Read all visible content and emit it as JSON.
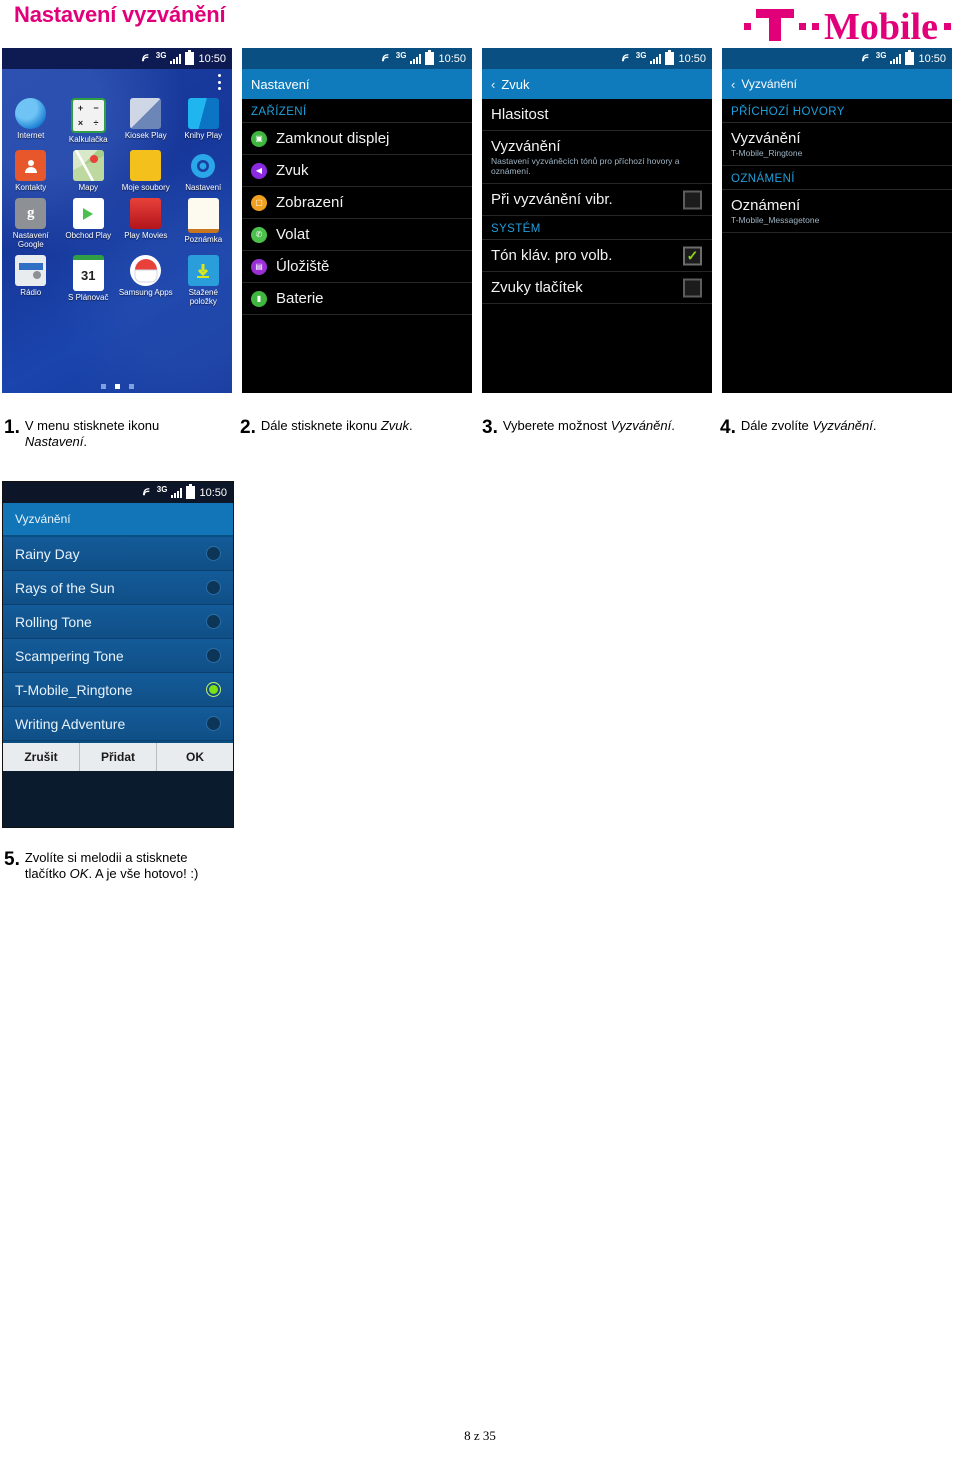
{
  "document": {
    "title": "Nastavení vyzvánění",
    "brand_logo": "T··Mobile·",
    "brand_color": "#e2007a",
    "footer": "8 z 35"
  },
  "status_bar": {
    "nfc_icon": "nfc-icon",
    "network": "3G",
    "signal_icon": "signal-bars-icon",
    "battery_icon": "battery-icon",
    "time": "10:50"
  },
  "screens": {
    "app_drawer": {
      "menu_icon": "overflow-menu-icon",
      "apps": [
        {
          "label": "Internet",
          "icon": "internet-icon"
        },
        {
          "label": "Kalkulačka",
          "icon": "calculator-icon"
        },
        {
          "label": "Kiosek Play",
          "icon": "play-newsstand-icon"
        },
        {
          "label": "Knihy Play",
          "icon": "play-books-icon"
        },
        {
          "label": "Kontakty",
          "icon": "contacts-icon"
        },
        {
          "label": "Mapy",
          "icon": "maps-icon"
        },
        {
          "label": "Moje soubory",
          "icon": "my-files-icon"
        },
        {
          "label": "Nastavení",
          "icon": "settings-gear-icon"
        },
        {
          "label": "Nastavení Google",
          "icon": "google-settings-icon"
        },
        {
          "label": "Obchod Play",
          "icon": "play-store-icon"
        },
        {
          "label": "Play Movies",
          "icon": "play-movies-icon"
        },
        {
          "label": "Poznámka",
          "icon": "memo-icon"
        },
        {
          "label": "Rádio",
          "icon": "radio-icon"
        },
        {
          "label": "S Plánovač",
          "icon": "calendar-icon"
        },
        {
          "label": "Samsung Apps",
          "icon": "samsung-apps-icon"
        },
        {
          "label": "Stažené položky",
          "icon": "downloads-icon"
        }
      ],
      "page_dots": 3,
      "active_page": 2
    },
    "settings": {
      "header": "Nastavení",
      "section": "ZAŘÍZENÍ",
      "rows": [
        {
          "label": "Zamknout displej",
          "icon": "lock-screen-icon",
          "color": "#3fb63f"
        },
        {
          "label": "Zvuk",
          "icon": "sound-speaker-icon",
          "color": "#8a2be2"
        },
        {
          "label": "Zobrazení",
          "icon": "display-icon",
          "color": "#f0a020"
        },
        {
          "label": "Volat",
          "icon": "phone-call-icon",
          "color": "#4cc04c"
        },
        {
          "label": "Úložiště",
          "icon": "storage-icon",
          "color": "#9b30d9"
        },
        {
          "label": "Baterie",
          "icon": "battery-icon",
          "color": "#3fb63f"
        }
      ]
    },
    "sound": {
      "header": "Zvuk",
      "back_icon": "back-chevron-icon",
      "rows": [
        {
          "label": "Hlasitost",
          "sub": "",
          "checkbox": null
        },
        {
          "label": "Vyzvánění",
          "sub": "Nastavení vyzváněcích tónů pro příchozí hovory a oznámení.",
          "checkbox": null
        },
        {
          "label": "Při vyzvánění vibr.",
          "sub": "",
          "checkbox": false
        }
      ],
      "section": "SYSTÉM",
      "system_rows": [
        {
          "label": "Tón kláv. pro volb.",
          "checkbox": true
        },
        {
          "label": "Zvuky tlačítek",
          "checkbox": false
        }
      ]
    },
    "ringtone_settings": {
      "header": "Vyzvánění",
      "back_icon": "back-chevron-icon",
      "section_calls": "PŘÍCHOZÍ HOVORY",
      "row_ringtone": {
        "label": "Vyzvánění",
        "sub": "T-Mobile_Ringtone"
      },
      "section_notif": "OZNÁMENÍ",
      "row_notif": {
        "label": "Oznámení",
        "sub": "T-Mobile_Messagetone"
      }
    },
    "ringtone_picker": {
      "title": "Vyzvánění",
      "items": [
        {
          "label": "Rainy Day",
          "selected": false
        },
        {
          "label": "Rays of the Sun",
          "selected": false
        },
        {
          "label": "Rolling Tone",
          "selected": false
        },
        {
          "label": "Scampering Tone",
          "selected": false
        },
        {
          "label": "T-Mobile_Ringtone",
          "selected": true
        },
        {
          "label": "Writing Adventure",
          "selected": false
        }
      ],
      "buttons": [
        "Zrušit",
        "Přidat",
        "OK"
      ]
    }
  },
  "steps": [
    {
      "num": "1.",
      "pre": "V menu stisknete ikonu ",
      "em": "Nastavení",
      "post": "."
    },
    {
      "num": "2.",
      "pre": "Dále stisknete ikonu ",
      "em": "Zvuk",
      "post": "."
    },
    {
      "num": "3.",
      "pre": "Vyberete možnost ",
      "em": "Vyzvánění",
      "post": "."
    },
    {
      "num": "4.",
      "pre": "Dále zvolíte ",
      "em": "Vyzvánění",
      "post": "."
    },
    {
      "num": "5.",
      "pre": "Zvolíte si melodii a stisknete tlačítko ",
      "em": "OK",
      "post": ". A je vše hotovo! :)"
    }
  ]
}
